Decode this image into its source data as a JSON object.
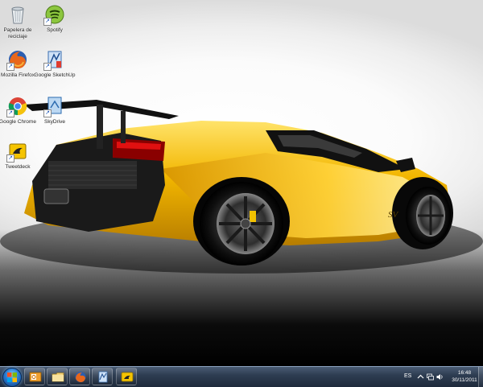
{
  "desktop": {
    "icons": [
      {
        "label": "Papelera de reciclaje",
        "icon": "recycle-bin-icon"
      },
      {
        "label": "Spotify",
        "icon": "spotify-icon"
      },
      {
        "label": "Mozilla Firefox",
        "icon": "firefox-icon"
      },
      {
        "label": "Google SketchUp",
        "icon": "sketchup-icon"
      },
      {
        "label": "Google Chrome",
        "icon": "chrome-icon"
      },
      {
        "label": "SkyDrive",
        "icon": "skydrive-icon"
      },
      {
        "label": "Tweetdeck",
        "icon": "tweetdeck-icon"
      }
    ],
    "wallpaper": "yellow-supercar-wallpaper"
  },
  "taskbar": {
    "start": "start-orb-icon",
    "pinned": [
      {
        "name": "outlook-icon",
        "color": "#f0a030"
      },
      {
        "name": "folder-icon",
        "color": "#f2d27a"
      },
      {
        "name": "firefox-icon",
        "color": "#e8671c"
      },
      {
        "name": "sketchup-icon",
        "color": "#4a9ad8"
      },
      {
        "name": "tweetdeck-icon",
        "color": "#f5c400"
      }
    ],
    "tray": {
      "language": "ES",
      "time": "16:48",
      "date": "30/11/2011"
    }
  }
}
